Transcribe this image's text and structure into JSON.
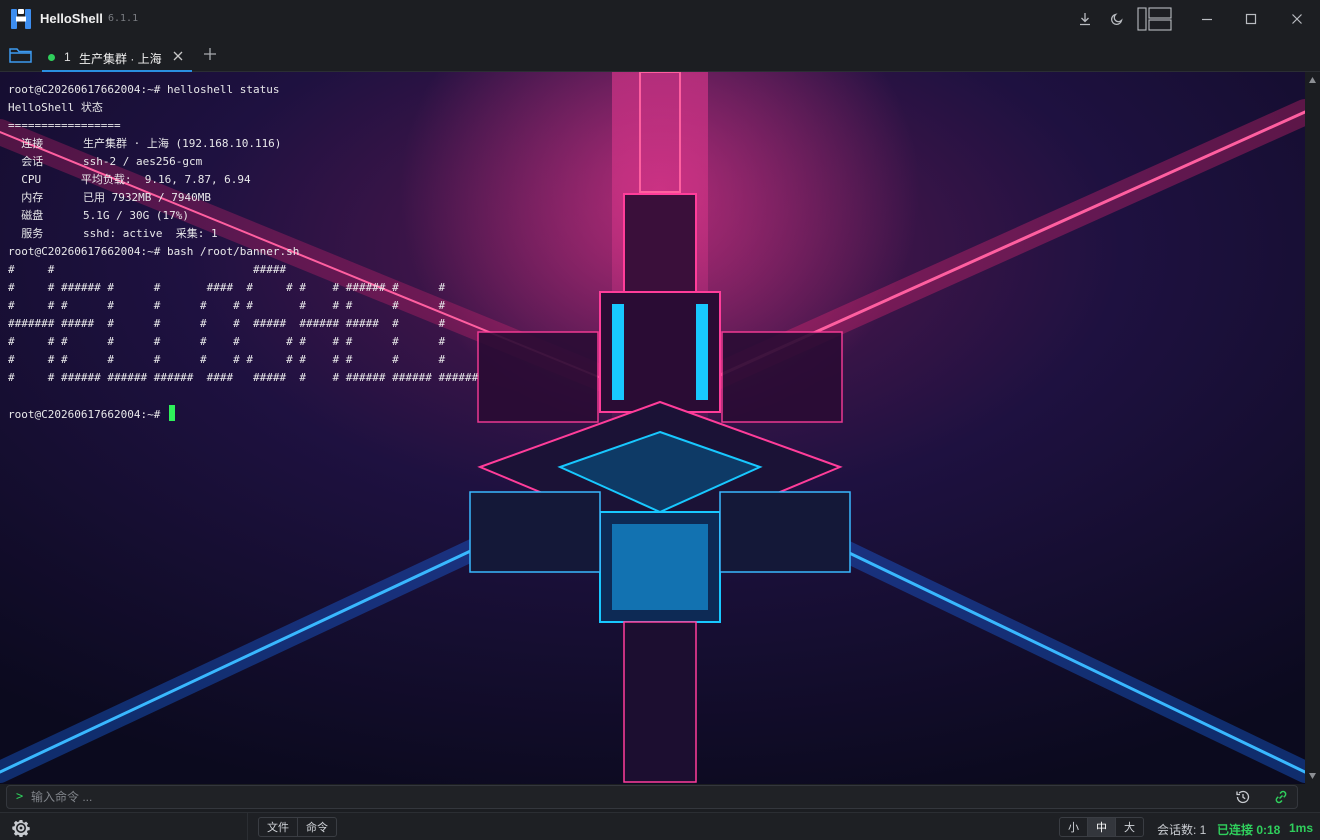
{
  "app": {
    "name": "HelloShell",
    "version": "6.1.1"
  },
  "tabs": [
    {
      "index": "1",
      "label": "生产集群 · 上海",
      "status_color": "#2fcf5c"
    }
  ],
  "terminal": {
    "lines": [
      "root@C20260617662004:~# helloshell status",
      "HelloShell 状态",
      "=================",
      "  连接      生产集群 · 上海 (192.168.10.116)",
      "  会话      ssh-2 / aes256-gcm",
      "  CPU      平均负载:  9.16, 7.87, 6.94",
      "  内存      已用 7932MB / 7940MB",
      "  磁盘      5.1G / 30G (17%)",
      "  服务      sshd: active  采集: 1",
      "root@C20260617662004:~# bash /root/banner.sh",
      "#     #                              #####",
      "#     # ###### #      #       ####  #     # #    # ###### #      #",
      "#     # #      #      #      #    # #       #    # #      #      #",
      "####### #####  #      #      #    #  #####  ###### #####  #      #",
      "#     # #      #      #      #    #       # #    # #      #      #",
      "#     # #      #      #      #    # #     # #    # #      #      #",
      "#     # ###### ###### ######  ####   #####  #    # ###### ###### ######",
      "",
      "root@C20260617662004:~# "
    ],
    "cursor_color": "#2ef05a"
  },
  "command_bar": {
    "prompt": ">",
    "placeholder": "输入命令 ..."
  },
  "status_bar": {
    "panel_tabs": [
      "文件",
      "命令"
    ],
    "font_sizes": [
      "小",
      "中",
      "大"
    ],
    "font_size_selected": "中",
    "session_count": "会话数: 1",
    "connection": "已连接 0:18",
    "latency": "1ms",
    "connected_color": "#2fcf5c"
  },
  "icons": {
    "logo": "helloshell-logo-icon",
    "download": "download-icon",
    "theme": "moon-icon",
    "layout": "layout-split-icon",
    "minimize": "minimize-icon",
    "maximize": "maximize-icon",
    "close": "close-icon",
    "folder": "folder-icon",
    "history": "history-icon",
    "link": "link-icon",
    "settings": "gear-icon"
  },
  "colors": {
    "accent": "#2a8fe0",
    "brand": "#3d8ef0",
    "neon_pink": "#ff2a7a",
    "neon_cyan": "#18c8ff"
  }
}
